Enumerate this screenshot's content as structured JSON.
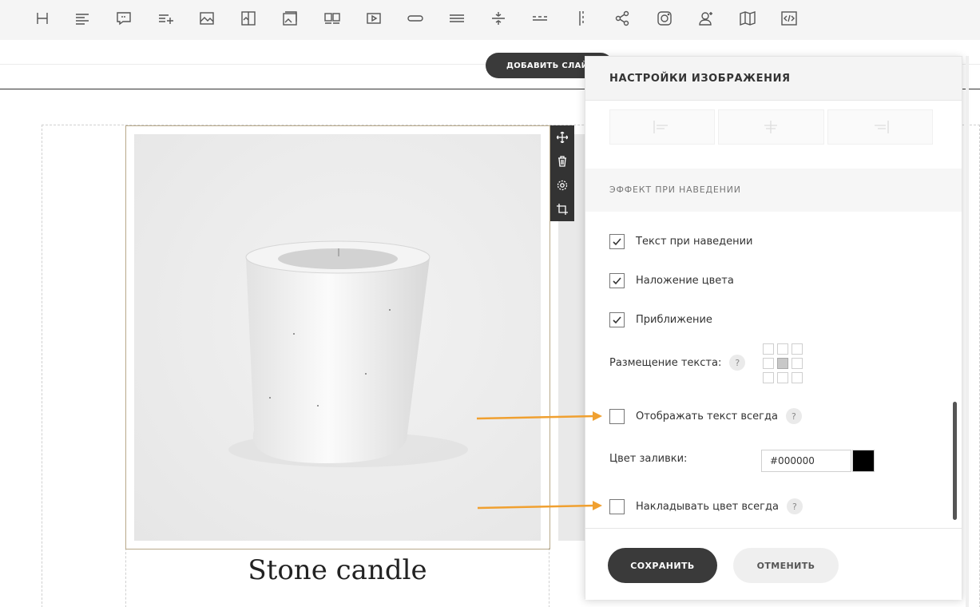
{
  "toolbar": {
    "icons": [
      "heading-icon",
      "text-icon",
      "quote-icon",
      "list-add-icon",
      "image-icon",
      "image-text-icon",
      "image-caption-icon",
      "gallery-icon",
      "video-icon",
      "button-icon",
      "divider-icon",
      "spacer-icon",
      "dashed-line-icon",
      "vertical-divider-icon",
      "share-icon",
      "instagram-icon",
      "user-add-icon",
      "map-icon",
      "code-icon"
    ]
  },
  "canvas": {
    "add_slide_label": "ДОБАВИТЬ СЛАЙД",
    "card_title": "Stone candle"
  },
  "panel": {
    "title": "НАСТРОЙКИ ИЗОБРАЖЕНИЯ",
    "section_label": "ЭФФЕКТ ПРИ НАВЕДЕНИИ",
    "checks": [
      {
        "label": "Текст при наведении",
        "checked": true
      },
      {
        "label": "Наложение цвета",
        "checked": true
      },
      {
        "label": "Приближение",
        "checked": true
      }
    ],
    "text_position_label": "Размещение текста:",
    "show_text_always_label": "Отображать текст всегда",
    "fill_color_label": "Цвет заливки:",
    "fill_color_value": "#000000",
    "overlay_always_label": "Накладывать цвет всегда",
    "help_glyph": "?",
    "save_label": "СОХРАНИТЬ",
    "cancel_label": "ОТМЕНИТЬ"
  },
  "colors": {
    "accent_arrow": "#f0a030",
    "button_dark": "#3a3a3a",
    "fill_swatch": "#000000"
  }
}
